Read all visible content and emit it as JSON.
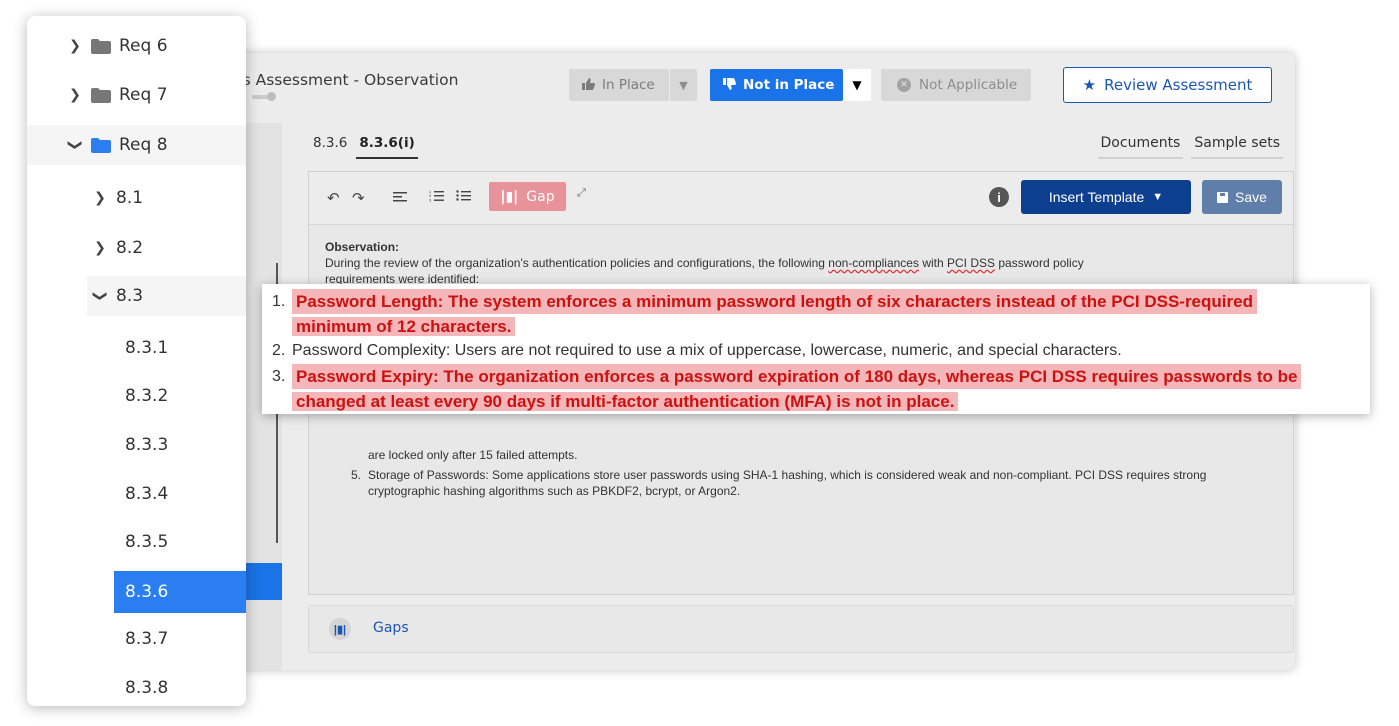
{
  "modal": {
    "title": "ils Assessment - Observation",
    "status_buttons": {
      "in_place": "In Place",
      "not_in_place": "Not in Place",
      "not_applicable": "Not Applicable",
      "selected": "Not in Place"
    },
    "review_button": "Review Assessment"
  },
  "tabs": [
    "8.3.6",
    "8.3.6(i)"
  ],
  "active_tab": "8.3.6(i)",
  "side_tabs": [
    "Documents",
    "Sample sets"
  ],
  "toolbar": {
    "gap_label": "Gap",
    "insert_template_label": "Insert Template",
    "save_label": "Save"
  },
  "observation": {
    "heading": "Observation:",
    "intro_before": "During the review of the organization's authentication policies and configurations, the following ",
    "intro_word": "non-compliances",
    "intro_middle": " with ",
    "intro_pci": "PCI DSS",
    "intro_after": " password policy",
    "intro_line2": "requirements were identified:",
    "items": [
      {
        "num": "",
        "text": "are locked only after 15 failed attempts."
      },
      {
        "num": "5.",
        "text": "Storage of Passwords: Some applications store user passwords using SHA-1 hashing, which is considered weak and non-compliant. PCI DSS requires strong cryptographic hashing algorithms such as PBKDF2, bcrypt, or Argon2."
      }
    ]
  },
  "gaps_panel": {
    "label": "Gaps"
  },
  "sidebar": {
    "items": [
      {
        "label": "Req 6"
      },
      {
        "label": "Req 7"
      },
      {
        "label": "Req 8"
      },
      {
        "label": "8.1"
      },
      {
        "label": "8.2"
      },
      {
        "label": "8.3"
      },
      {
        "label": "8.3.1"
      },
      {
        "label": "8.3.2"
      },
      {
        "label": "8.3.3"
      },
      {
        "label": "8.3.4"
      },
      {
        "label": "8.3.5"
      },
      {
        "label": "8.3.6"
      },
      {
        "label": "8.3.7"
      },
      {
        "label": "8.3.8"
      }
    ],
    "selected": "8.3.6"
  },
  "callout": {
    "items": [
      {
        "num": "1.",
        "line1": "Password Length: The system enforces a minimum password length of six characters instead of the PCI DSS-required",
        "line2": "minimum of 12 characters.",
        "highlight": true
      },
      {
        "num": "2.",
        "line1": "Password Complexity: Users are not required to use a mix of uppercase, lowercase, numeric, and special characters.",
        "highlight": false
      },
      {
        "num": "3.",
        "line1": "Password Expiry: The organization enforces a password expiration of 180 days, whereas PCI DSS requires passwords to be",
        "line2": "changed at least every 90 days if multi-factor authentication (MFA) is not in place.",
        "highlight": true
      }
    ]
  },
  "colors": {
    "accent": "#1a73e8",
    "navy": "#0c3f8e",
    "highlight_bg": "#f4b6b8",
    "highlight_text": "#cc1111"
  },
  "icons": [
    "thumbs-up-icon",
    "thumbs-down-icon",
    "caret-down-icon",
    "close-circle-icon",
    "star-icon",
    "undo-icon",
    "redo-icon",
    "align-icon",
    "ordered-list-icon",
    "bullet-list-icon",
    "gap-icon",
    "expand-icon",
    "info-icon",
    "save-icon",
    "chevron-right-icon",
    "chevron-down-icon",
    "folder-icon"
  ]
}
